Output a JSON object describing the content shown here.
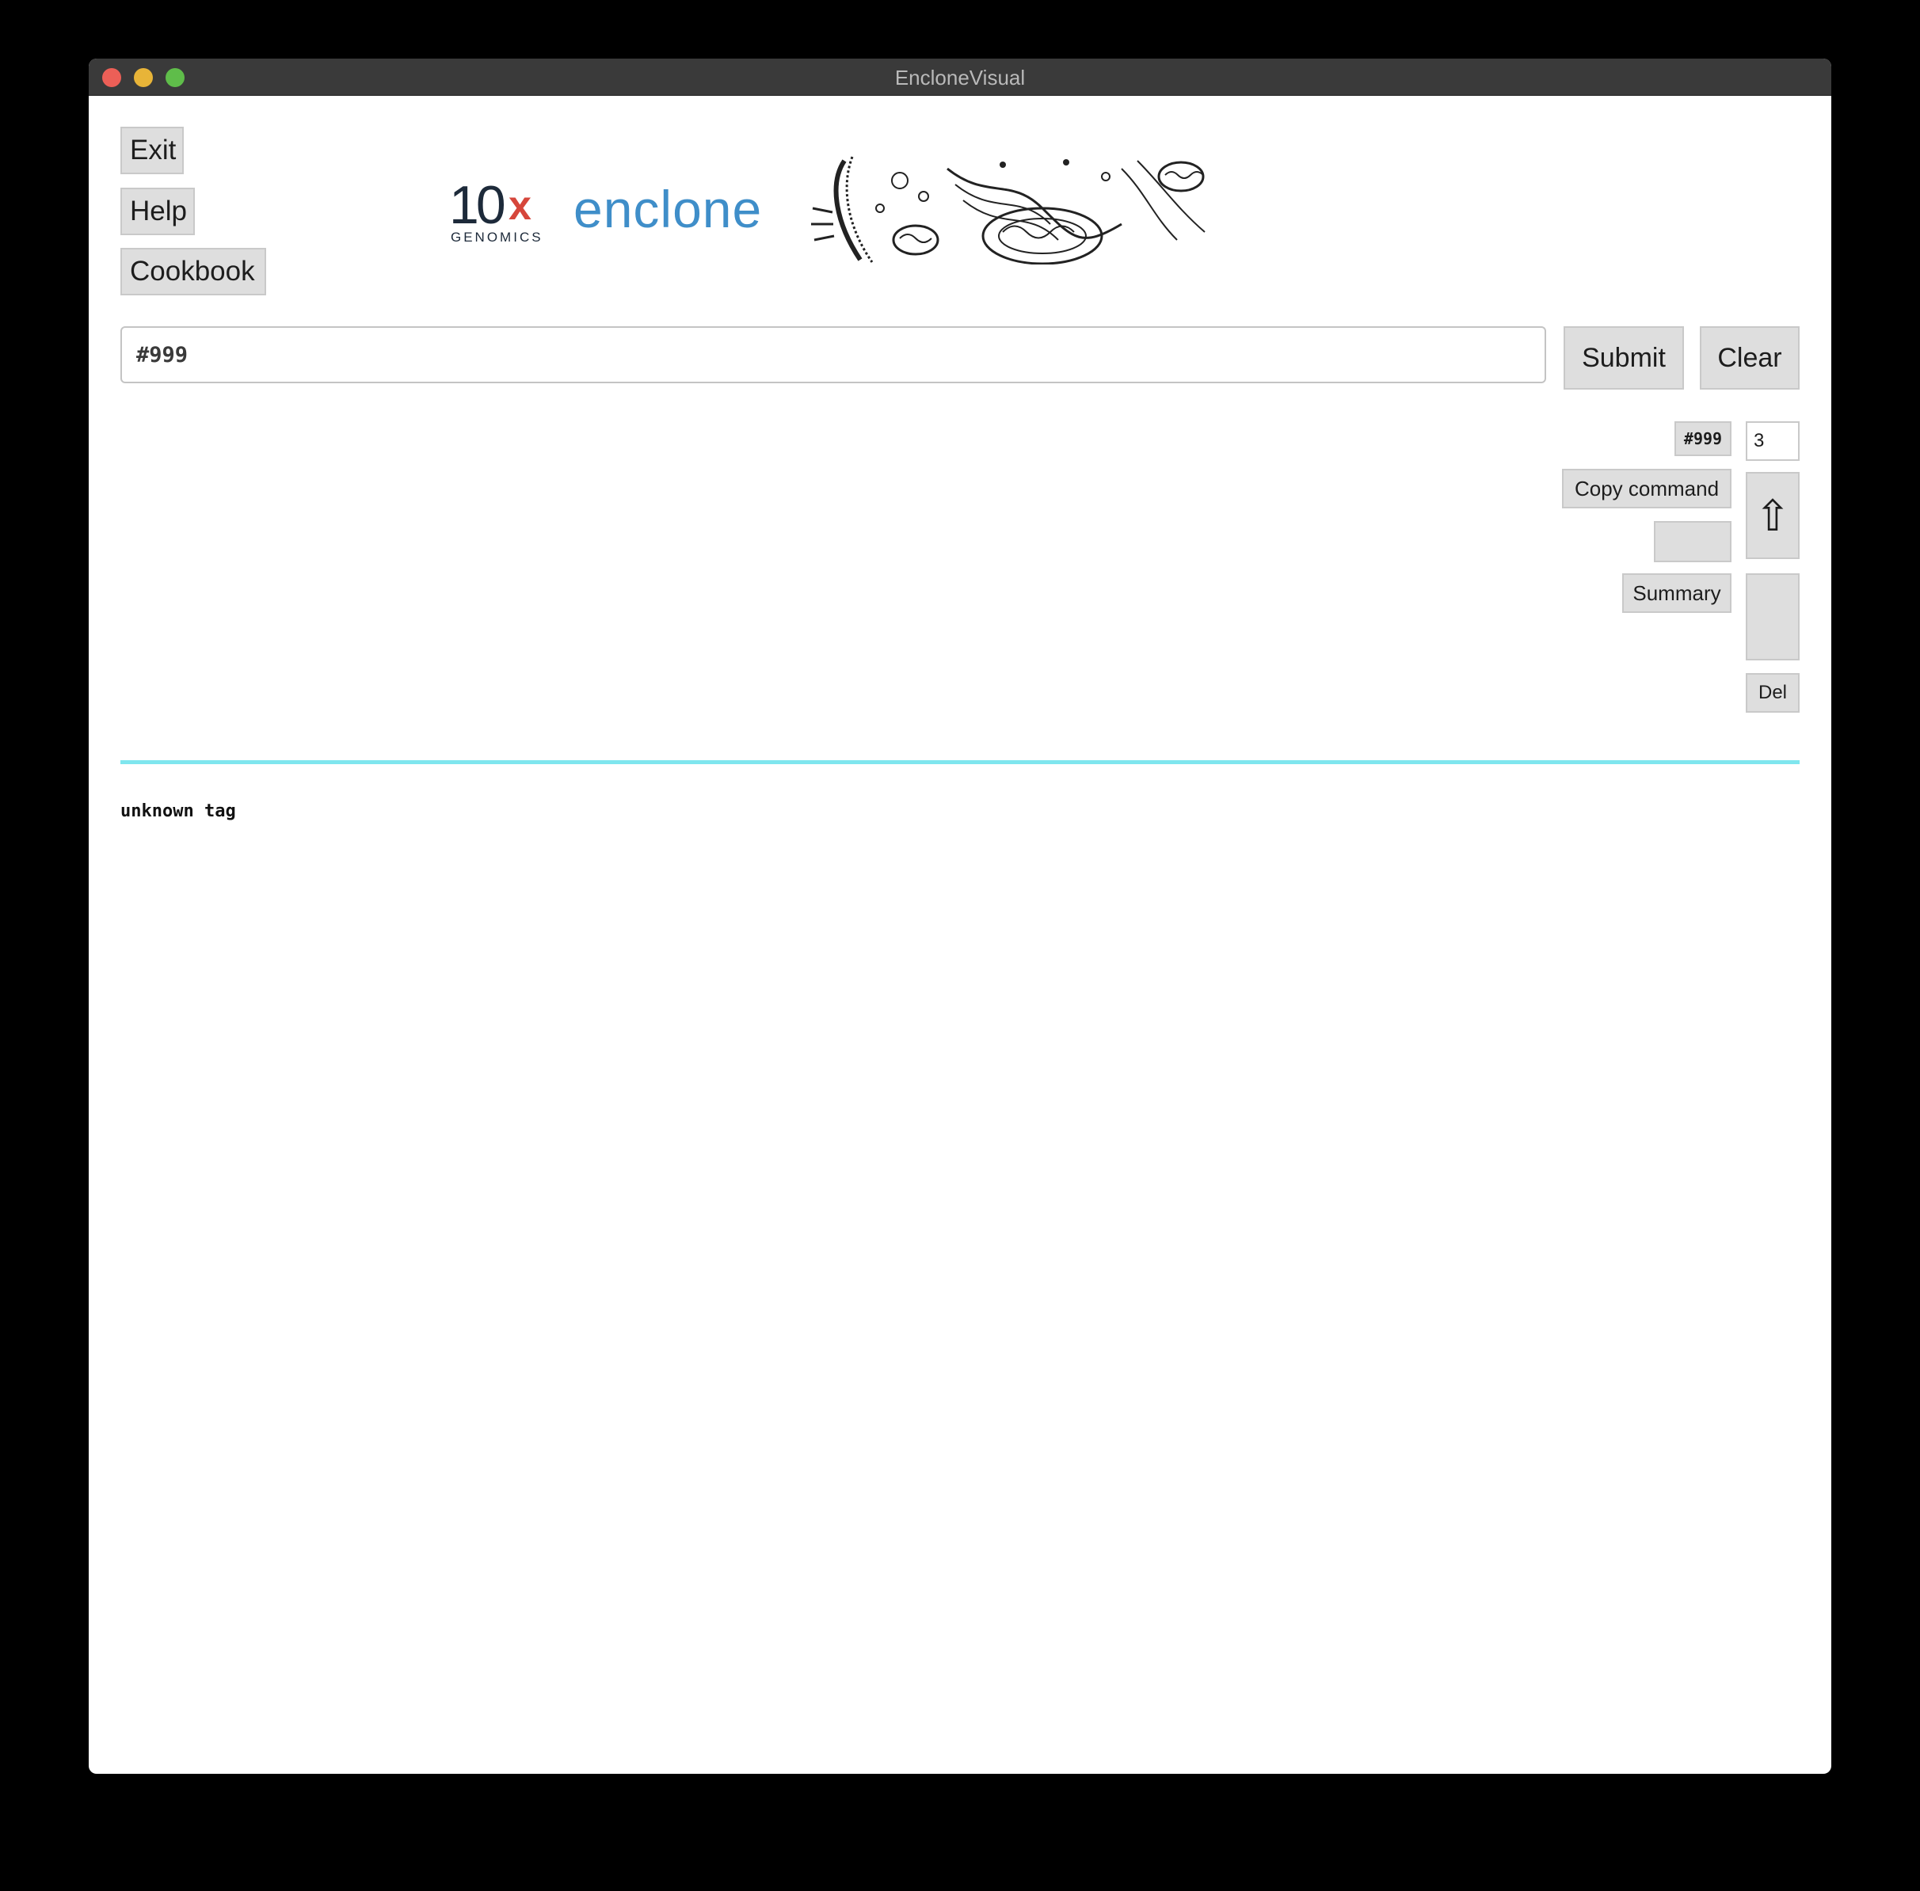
{
  "window": {
    "title": "EncloneVisual"
  },
  "buttons": {
    "exit": "Exit",
    "help": "Help",
    "cookbook": "Cookbook",
    "submit": "Submit",
    "clear": "Clear",
    "copy_command": "Copy command",
    "summary": "Summary",
    "del": "Del",
    "up_arrow": "⇧"
  },
  "logos": {
    "tenx_number": "10",
    "tenx_x": "x",
    "tenx_subtitle": "GENOMICS",
    "enclone": "enclone"
  },
  "command": {
    "value": "#999"
  },
  "history": {
    "tag": "#999",
    "index": "3"
  },
  "output": {
    "text": "unknown tag"
  },
  "colors": {
    "rule": "#7fe6ee",
    "enclone_blue": "#3f8ec9",
    "tenx_red": "#d6463b"
  }
}
